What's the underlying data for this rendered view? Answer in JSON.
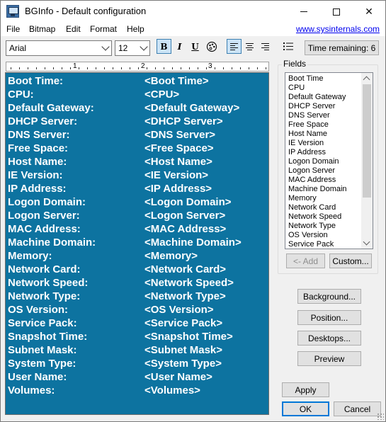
{
  "window": {
    "title": "BGInfo - Default configuration"
  },
  "menu": {
    "items": [
      "File",
      "Bitmap",
      "Edit",
      "Format",
      "Help"
    ],
    "link": "www.sysinternals.com"
  },
  "toolbar": {
    "font_name": "Arial",
    "font_size": "12",
    "bold": "B",
    "italic": "I",
    "underline": "U",
    "time_remaining": "Time remaining: 6"
  },
  "ruler": {
    "numbers": [
      "1",
      "2",
      "3"
    ]
  },
  "editor": {
    "background": "#0d73a0",
    "lines": [
      {
        "label": "Boot Time:",
        "field": "<Boot Time>"
      },
      {
        "label": "CPU:",
        "field": "<CPU>"
      },
      {
        "label": "Default Gateway:",
        "field": "<Default Gateway>"
      },
      {
        "label": "DHCP Server:",
        "field": "<DHCP Server>"
      },
      {
        "label": "DNS Server:",
        "field": "<DNS Server>"
      },
      {
        "label": "Free Space:",
        "field": "<Free Space>"
      },
      {
        "label": "Host Name:",
        "field": "<Host Name>"
      },
      {
        "label": "IE Version:",
        "field": "<IE Version>"
      },
      {
        "label": "IP Address:",
        "field": "<IP Address>"
      },
      {
        "label": "Logon Domain:",
        "field": "<Logon Domain>"
      },
      {
        "label": "Logon Server:",
        "field": "<Logon Server>"
      },
      {
        "label": "MAC Address:",
        "field": "<MAC Address>"
      },
      {
        "label": "Machine Domain:",
        "field": "<Machine Domain>"
      },
      {
        "label": "Memory:",
        "field": "<Memory>"
      },
      {
        "label": "Network Card:",
        "field": "<Network Card>"
      },
      {
        "label": "Network Speed:",
        "field": "<Network Speed>"
      },
      {
        "label": "Network Type:",
        "field": "<Network Type>"
      },
      {
        "label": "OS Version:",
        "field": "<OS Version>"
      },
      {
        "label": "Service Pack:",
        "field": "<Service Pack>"
      },
      {
        "label": "Snapshot Time:",
        "field": "<Snapshot Time>"
      },
      {
        "label": "Subnet Mask:",
        "field": "<Subnet Mask>"
      },
      {
        "label": "System Type:",
        "field": "<System Type>"
      },
      {
        "label": "User Name:",
        "field": "<User Name>"
      },
      {
        "label": "Volumes:",
        "field": "<Volumes>"
      }
    ]
  },
  "fields": {
    "legend": "Fields",
    "items": [
      "Boot Time",
      "CPU",
      "Default Gateway",
      "DHCP Server",
      "DNS Server",
      "Free Space",
      "Host Name",
      "IE Version",
      "IP Address",
      "Logon Domain",
      "Logon Server",
      "MAC Address",
      "Machine Domain",
      "Memory",
      "Network Card",
      "Network Speed",
      "Network Type",
      "OS Version",
      "Service Pack"
    ],
    "add_label": "<- Add",
    "custom_label": "Custom..."
  },
  "buttons": {
    "background": "Background...",
    "position": "Position...",
    "desktops": "Desktops...",
    "preview": "Preview",
    "apply": "Apply",
    "ok": "OK",
    "cancel": "Cancel"
  }
}
